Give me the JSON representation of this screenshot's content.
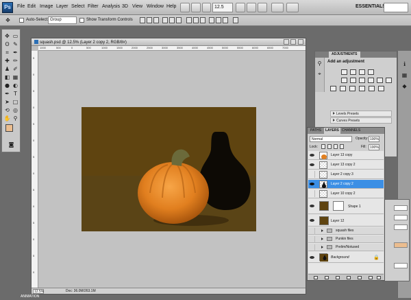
{
  "app": {
    "logo": "Ps",
    "workspace": "ESSENTIALS",
    "zoom": "12.5"
  },
  "menu": [
    "File",
    "Edit",
    "Image",
    "Layer",
    "Select",
    "Filter",
    "Analysis",
    "3D",
    "View",
    "Window",
    "Help"
  ],
  "options": {
    "auto_select_label": "Auto-Select:",
    "auto_select_value": "Group",
    "transform_label": "Show Transform Controls"
  },
  "document": {
    "title": "squash.psd @ 12.5% (Layer 2 copy 2, RGB/8#)",
    "zoom": "12.5%",
    "info": "Doc: 36.0M/263.1M",
    "ruler_h": [
      "1000",
      "500",
      "0",
      "500",
      "1000",
      "1500",
      "2000",
      "2500",
      "3000",
      "3500",
      "4000",
      "4500",
      "5000",
      "5500",
      "6000",
      "6500",
      "7000"
    ],
    "ruler_v": [
      "5",
      "0",
      "5",
      "0",
      "5",
      "0",
      "5",
      "0",
      "5",
      "0",
      "5",
      "0",
      "5",
      "0"
    ]
  },
  "adjustments": {
    "tab": "ADJUSTMENTS",
    "title": "Add an adjustment",
    "presets": [
      "Levels Presets",
      "Curves Presets"
    ]
  },
  "layers": {
    "tabs": [
      "PATHS",
      "LAYERS",
      "CHANNELS"
    ],
    "blend_mode": "Normal",
    "opacity_label": "Opacity:",
    "opacity": "100%",
    "lock_label": "Lock:",
    "fill_label": "Fill:",
    "fill": "100%",
    "items": [
      {
        "name": "Layer 13 copy",
        "type": "layer"
      },
      {
        "name": "Layer 13 copy 2",
        "type": "layer"
      },
      {
        "name": "Layer 2 copy 3",
        "type": "layer"
      },
      {
        "name": "Layer 2 copy 2",
        "type": "layer",
        "selected": true
      },
      {
        "name": "Layer 10 copy 2",
        "type": "layer"
      },
      {
        "name": "Shape 1",
        "type": "shape"
      },
      {
        "name": "Layer 12",
        "type": "layer"
      },
      {
        "name": "squash files",
        "type": "group"
      },
      {
        "name": "Punkin files",
        "type": "group"
      },
      {
        "name": "Prelim/Notused",
        "type": "group"
      },
      {
        "name": "Background",
        "type": "background"
      }
    ]
  },
  "colors": {
    "foreground": "#ebbd8f",
    "background": "#ffffff",
    "accent": "#3c8fe5"
  },
  "taskbar": {
    "label": "ANIMATION"
  }
}
